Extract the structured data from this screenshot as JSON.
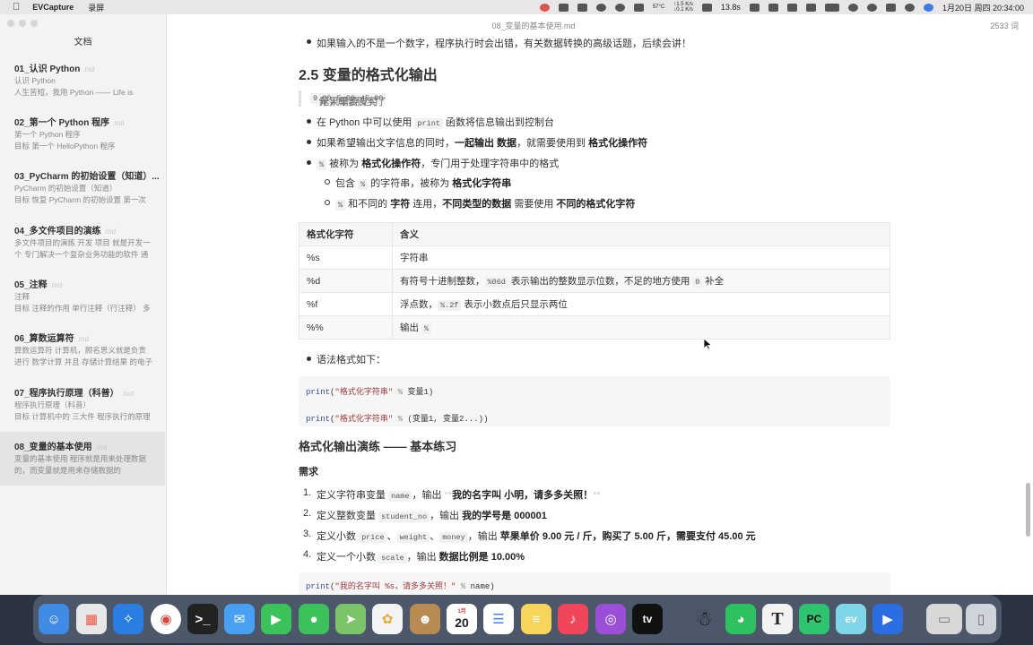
{
  "menubar": {
    "app_name": "EVCapture",
    "menu_item": "录屏",
    "weather": "57°C",
    "network_up": "↑1.5 K/s",
    "network_down": "↓0.1 K/s",
    "timer": "13.8s",
    "datetime": "1月20日 周四  20:34:00"
  },
  "window": {
    "title": "08_变量的基本使用.md",
    "word_count": "2533 词"
  },
  "sidebar": {
    "header": "文档",
    "files": [
      {
        "name": "01_认识 Python",
        "ext": ".md",
        "excerpt1": "认识 Python",
        "excerpt2": "人生苦短，我用 Python —— Life is"
      },
      {
        "name": "02_第一个 Python 程序",
        "ext": ".md",
        "excerpt1": "第一个 Python 程序",
        "excerpt2": "目标 第一个 HelloPython 程序"
      },
      {
        "name": "03_PyCharm 的初始设置（知道）...",
        "ext": "",
        "excerpt1": "PyCharm 的初始设置（知道）",
        "excerpt2": "目标 恢复 PyCharm 的初始设置 第一次"
      },
      {
        "name": "04_多文件项目的演练",
        "ext": ".md",
        "excerpt1": "多文件项目的演练 开发 项目 就是开发一",
        "excerpt2": "个 专门解决一个复杂业务功能的软件 通"
      },
      {
        "name": "05_注释",
        "ext": ".md",
        "excerpt1": "注释",
        "excerpt2": "目标 注释的作用 单行注释（行注释） 多"
      },
      {
        "name": "06_算数运算符",
        "ext": ".md",
        "excerpt1": "算数运算符 计算机，顾名思义就是负责",
        "excerpt2": "进行 数学计算 并且 存储计算结果 的电子"
      },
      {
        "name": "07_程序执行原理（科普）",
        "ext": ".md",
        "excerpt1": "程序执行原理（科普）",
        "excerpt2": "目标 计算机中的 三大件 程序执行的原理"
      },
      {
        "name": "08_变量的基本使用",
        "ext": ".md",
        "excerpt1": "变量的基本使用 程序就是用来处理数据",
        "excerpt2": "的，而变量就是用来存储数据的"
      }
    ]
  },
  "doc": {
    "line_top": "如果输入的不是一个数字，程序执行时会出错，有关数据转换的高级话题，后续会讲！",
    "h2": "2.5 变量的格式化输出",
    "quote": {
      "a": "苹果单价 ",
      "c1": "9.00",
      "b": " 元 / 斤，购买了 ",
      "c2": "5.00",
      "c": " 斤，需要支付 ",
      "c3": "45.00",
      "d": " 元"
    },
    "b1": {
      "a": "在 Python 中可以使用 ",
      "code": "print",
      "b": " 函数将信息输出到控制台"
    },
    "b2": {
      "a": "如果希望输出文字信息的同时，",
      "s1": "一起输出 数据",
      "b": "，就需要使用到 ",
      "s2": "格式化操作符"
    },
    "b3": {
      "code": "%",
      "a": " 被称为 ",
      "s1": "格式化操作符",
      "b": "，专门用于处理字符串中的格式"
    },
    "sub1": {
      "a": "包含 ",
      "code": "%",
      "b": " 的字符串，被称为 ",
      "s1": "格式化字符串"
    },
    "sub2": {
      "code": "%",
      "a": " 和不同的 ",
      "s1": "字符",
      "b": " 连用，",
      "s2": "不同类型的数据",
      "c": " 需要使用 ",
      "s3": "不同的格式化字符"
    },
    "table": {
      "headers": [
        "格式化字符",
        "含义"
      ],
      "rows": [
        {
          "k": "%s",
          "a": "字符串",
          "code": "",
          "b": "",
          "code2": "",
          "c": ""
        },
        {
          "k": "%d",
          "a": "有符号十进制整数，",
          "code": "%06d",
          "b": " 表示输出的整数显示位数，不足的地方使用 ",
          "code2": "0",
          "c": " 补全"
        },
        {
          "k": "%f",
          "a": "浮点数，",
          "code": "%.2f",
          "b": " 表示小数点后只显示两位",
          "code2": "",
          "c": ""
        },
        {
          "k": "%%",
          "a": "输出 ",
          "code": "%",
          "b": "",
          "code2": "",
          "c": ""
        }
      ]
    },
    "syntax_label": "语法格式如下：",
    "code1": {
      "fn": "print",
      "str": "\"格式化字符串\"",
      "op": "%",
      "arg": "变量1",
      "close": ")"
    },
    "code2": {
      "fn": "print",
      "str": "\"格式化字符串\"",
      "op": "%",
      "arg": "(变量1, 变量2...)",
      "close": ")"
    },
    "h3": "格式化输出演练 —— 基本练习",
    "need": "需求",
    "reqs": [
      {
        "n": "1.",
        "a": "定义字符串变量 ",
        "code": "name",
        "b": "，输出 ",
        "m1": "**",
        "s": "我的名字叫 小明，请多多关照！",
        "m2": "**"
      },
      {
        "n": "2.",
        "a": "定义整数变量 ",
        "code": "student_no",
        "b": "，输出 ",
        "s": "我的学号是 000001"
      },
      {
        "n": "3.",
        "a": "定义小数 ",
        "code": "price",
        "sep1": "、",
        "code2": "weight",
        "sep2": "、",
        "code3": "money",
        "b": "，输出 ",
        "s": "苹果单价 9.00 元 / 斤，购买了 5.00 斤，需要支付 45.00 元"
      },
      {
        "n": "4.",
        "a": "定义一个小数 ",
        "code": "scale",
        "b": "，输出 ",
        "s": "数据比例是 10.00%"
      }
    ],
    "code3": {
      "fn": "print",
      "str": "\"我的名字叫 %s，请多多关照！\"",
      "op": "%",
      "arg": "name",
      "close": ")"
    }
  },
  "dock": {
    "apps": [
      "finder-icon",
      "launchpad-icon",
      "safari-icon",
      "chrome-icon",
      "terminal-icon",
      "mail-icon",
      "facetime-icon",
      "messages-icon",
      "maps-icon",
      "photos-icon",
      "contacts-icon",
      "calendar-icon",
      "reminders-icon",
      "notes-icon",
      "music-icon",
      "podcasts-icon",
      "appletv-icon",
      "qq-icon",
      "wechat-icon",
      "typora-icon",
      "pycharm-icon",
      "evcapture-icon",
      "screen-icon",
      "downloads-icon",
      "trash-icon"
    ],
    "calendar_month": "1月",
    "calendar_day": "20"
  }
}
